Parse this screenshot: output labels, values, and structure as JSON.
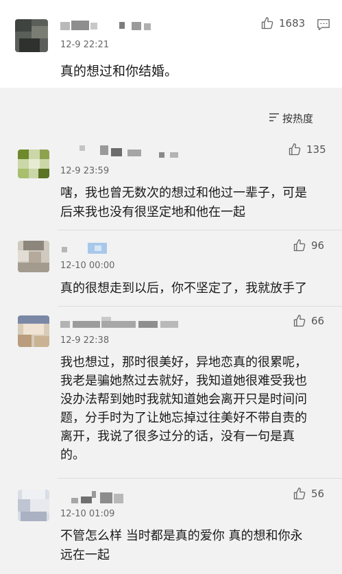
{
  "main_post": {
    "time": "12-9 22:21",
    "content": "真的想过和你结婚。",
    "likes": "1683",
    "icons": {
      "like": "thumbs-up-icon",
      "comment": "comment-icon"
    }
  },
  "sort": {
    "label": "按热度",
    "icon": "sort-icon"
  },
  "comments": [
    {
      "time": "12-9 23:59",
      "likes": "135",
      "lines": [
        "嗐，我也曾无数次的想过和他过一辈子，可是",
        "后来我也没有很坚定地和他在一起"
      ]
    },
    {
      "time": "12-10 00:00",
      "likes": "96",
      "lines": [
        "真的很想走到以后，你不坚定了，我就放手了"
      ]
    },
    {
      "time": "12-9 22:38",
      "likes": "66",
      "lines": [
        "我也想过，那时很美好，异地恋真的很累呢，",
        "我老是骗她熬过去就好，我知道她很难受我也",
        "没办法帮到她时我就知道她会离开只是时间问",
        "题，分手时为了让她忘掉过往美好不带自责的",
        "离开，我说了很多过分的话，没有一句是真",
        "的。"
      ]
    },
    {
      "time": "12-10 01:09",
      "likes": "56",
      "lines": [
        "不管怎么样 当时都是真的爱你 真的想和你永",
        "远在一起"
      ]
    }
  ]
}
